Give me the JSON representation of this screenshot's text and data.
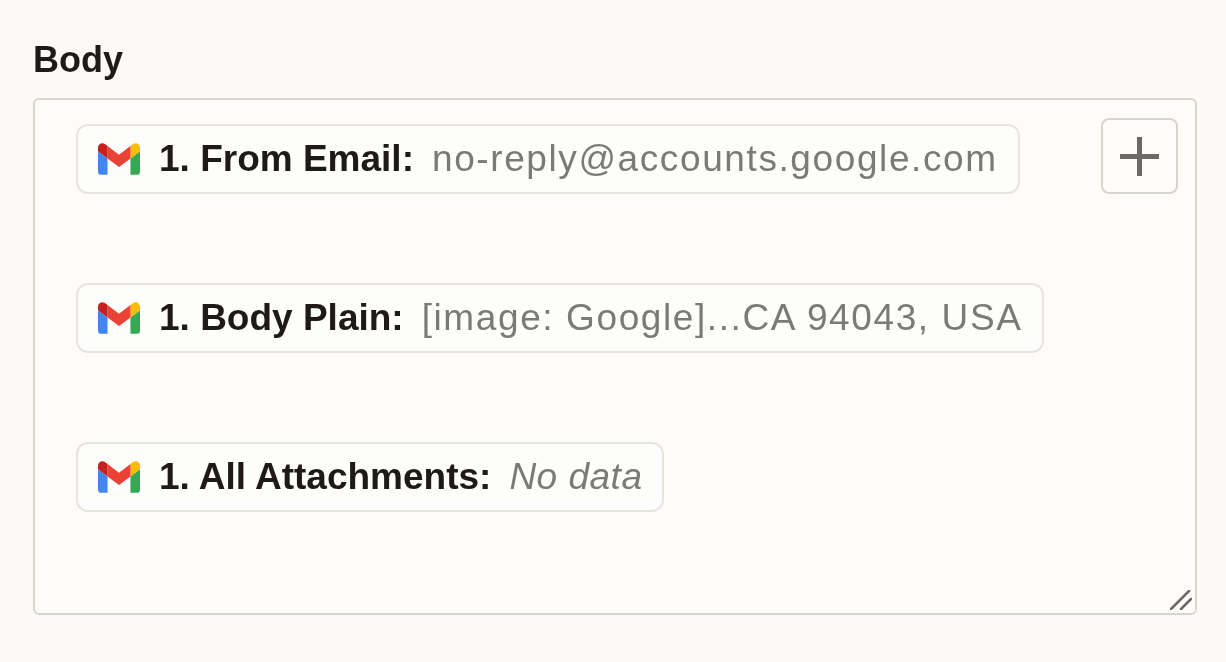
{
  "field": {
    "label": "Body"
  },
  "tokens": [
    {
      "kind": "value",
      "label": "1. From Email:",
      "value": "no-reply@accounts.google.com"
    },
    {
      "kind": "value",
      "label": "1. Body Plain:",
      "value": "[image: Google]...CA 94043, USA"
    },
    {
      "kind": "empty",
      "label": "1. All Attachments:",
      "value": "No data"
    }
  ]
}
